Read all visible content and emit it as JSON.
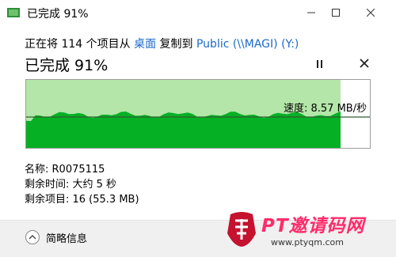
{
  "window": {
    "title": "已完成 91%",
    "minimize_icon": "minimize-icon",
    "maximize_icon": "maximize-icon",
    "close_icon": "close-icon"
  },
  "operation": {
    "prefix": "正在将 114 个项目从 ",
    "source": "桌面",
    "middle": " 复制到 ",
    "destination": "Public (\\\\MAGI) (Y:)"
  },
  "status": {
    "percent_text": "已完成 91%",
    "progress": 0.91
  },
  "graph": {
    "speed_label": "速度: 8.57 MB/秒",
    "colors": {
      "done_bg": "#b3e6a8",
      "fill": "#06b025",
      "line": "#2f5f2f"
    }
  },
  "details": {
    "name_label": "名称: R0075115",
    "time_label": "剩余时间: 大约 5 秒",
    "items_label": "剩余项目: 16 (55.3 MB)"
  },
  "footer": {
    "collapse_label": "简略信息"
  },
  "watermark": {
    "brand": "PT邀请码网",
    "url": "www.ptyqm.com"
  }
}
